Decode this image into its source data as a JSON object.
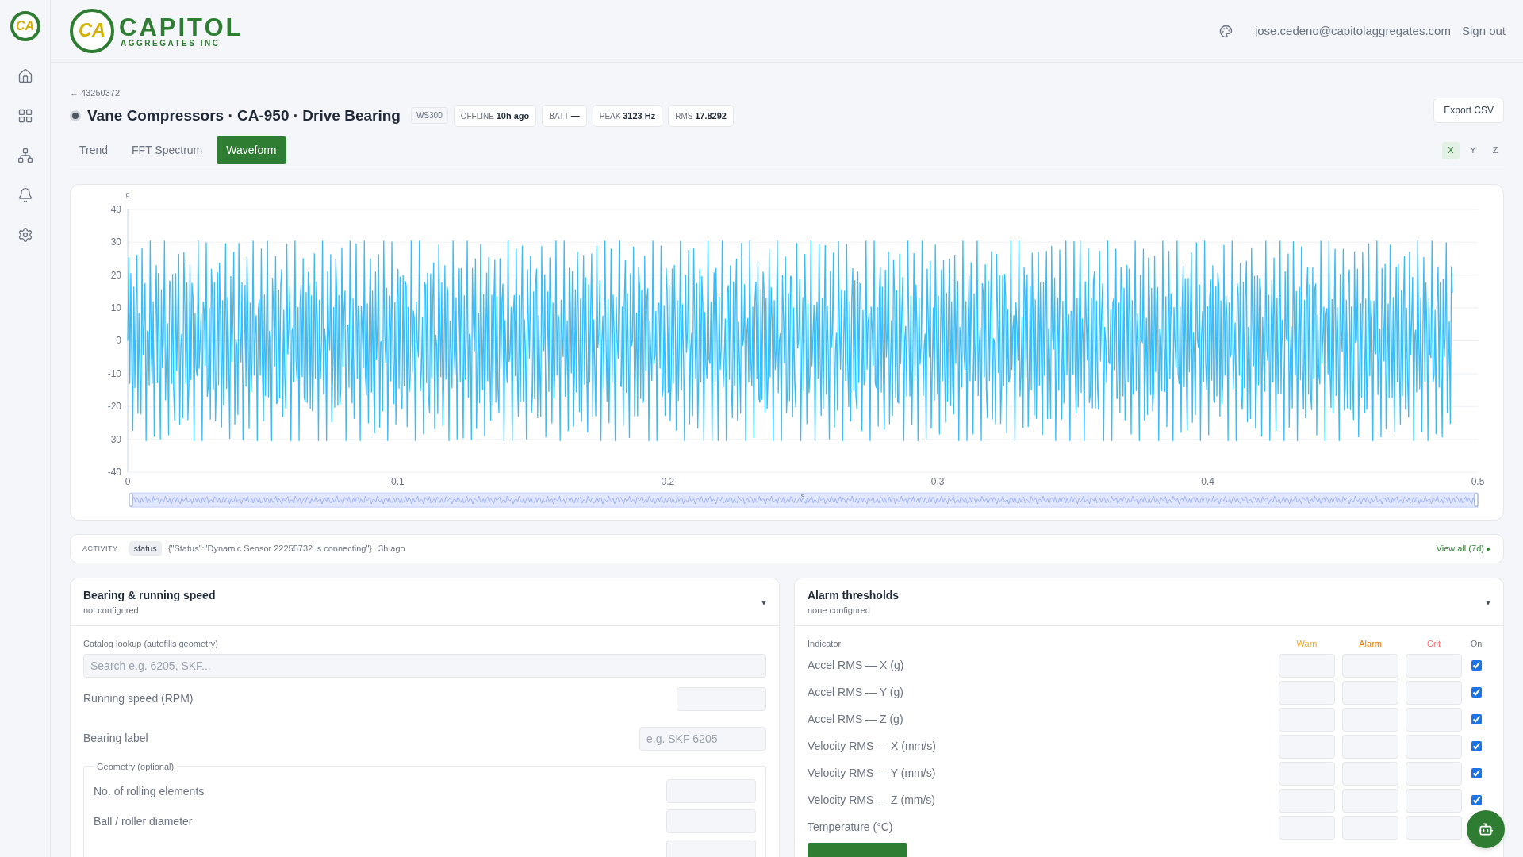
{
  "logo": {
    "mark": "CA",
    "name": "CAPITOL",
    "sub": "AGGREGATES INC"
  },
  "sidebar": {
    "logo_mark": "CA",
    "items": [
      {
        "kind": "home"
      },
      {
        "kind": "grid"
      },
      {
        "kind": "network"
      },
      {
        "kind": "bell"
      },
      {
        "kind": "settings"
      }
    ]
  },
  "header": {
    "user": "jose.cedeno@capitolaggregates.com",
    "sign_out": "Sign out"
  },
  "back_link": "← 43250372",
  "export_button": "Export CSV",
  "title": "Vane Compressors · CA-950 · Drive Bearing",
  "model_badge": "WS300",
  "stats": [
    {
      "label": "OFFLINE",
      "value": "10h ago"
    },
    {
      "label": "BATT",
      "value": "—"
    },
    {
      "label": "PEAK",
      "value": "3123 Hz"
    },
    {
      "label": "RMS",
      "value": "17.8292"
    }
  ],
  "tabs": [
    {
      "label": "Trend",
      "selected": false
    },
    {
      "label": "FFT Spectrum",
      "selected": false
    },
    {
      "label": "Waveform",
      "selected": true
    }
  ],
  "axes": [
    {
      "label": "X",
      "selected": true
    },
    {
      "label": "Y",
      "selected": false
    },
    {
      "label": "Z",
      "selected": false
    }
  ],
  "chart": {
    "y_unit": "g",
    "x_unit": "s",
    "y_ticks": [
      "40",
      "30",
      "20",
      "10",
      "0",
      "-10",
      "-20",
      "-30",
      "-40"
    ],
    "x_ticks": [
      "0",
      "0.1",
      "0.2",
      "0.3",
      "0.4",
      "0.5"
    ]
  },
  "activity": {
    "label": "ACTIVITY",
    "tag": "status",
    "message": "{\"Status\":\"Dynamic Sensor 22255732 is connecting\"}",
    "time": "3h ago",
    "link": "View all (7d) ▸"
  },
  "bearing": {
    "title": "Bearing & running speed",
    "subtitle": "not configured",
    "caret": "▾",
    "catalog_label": "Catalog lookup (autofills geometry)",
    "catalog_placeholder": "Search e.g. 6205, SKF...",
    "running_speed": "Running speed (RPM)",
    "bearing_label": "Bearing label",
    "bearing_placeholder": "e.g. SKF 6205",
    "geometry_legend": "Geometry (optional)",
    "geometry_fields": [
      "No. of rolling elements",
      "Ball / roller diameter"
    ]
  },
  "alarms": {
    "title": "Alarm thresholds",
    "subtitle": "none configured",
    "caret": "▾",
    "columns": {
      "indicator": "Indicator",
      "warn": "Warn",
      "alarm": "Alarm",
      "crit": "Crit",
      "on": "On"
    },
    "rows": [
      {
        "name": "Accel RMS — X (g)",
        "on": true
      },
      {
        "name": "Accel RMS — Y (g)",
        "on": true
      },
      {
        "name": "Accel RMS — Z (g)",
        "on": true
      },
      {
        "name": "Velocity RMS — X (mm/s)",
        "on": true
      },
      {
        "name": "Velocity RMS — Y (mm/s)",
        "on": true
      },
      {
        "name": "Velocity RMS — Z (mm/s)",
        "on": true
      },
      {
        "name": "Temperature (°C)"
      }
    ]
  }
}
